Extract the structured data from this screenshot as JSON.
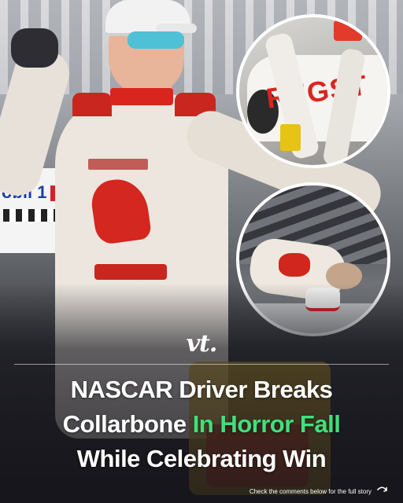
{
  "post": {
    "banner_text": "obil 1",
    "car_text": "REGST",
    "logo": "vt.",
    "headline": {
      "line1": "NASCAR Driver Breaks",
      "line2_start": "Collarbone ",
      "line2_highlight": "In Horror Fall",
      "line3": "While Celebrating Win"
    },
    "footer_text": "Check the comments below for the full story",
    "footer_icon": "curved-arrow-icon"
  },
  "colors": {
    "highlight": "#3fe07d",
    "text": "#ffffff",
    "accent_red": "#d9251d"
  }
}
